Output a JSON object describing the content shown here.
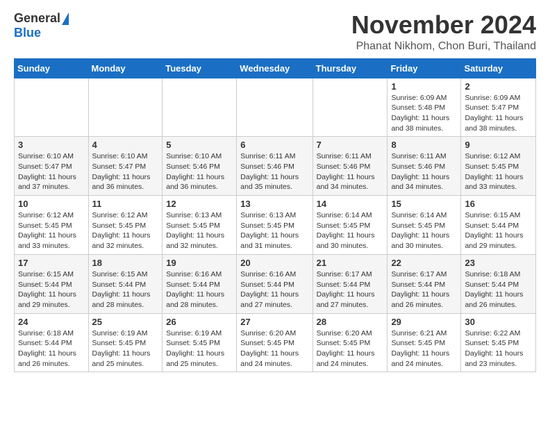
{
  "header": {
    "logo_general": "General",
    "logo_blue": "Blue",
    "month_title": "November 2024",
    "location": "Phanat Nikhom, Chon Buri, Thailand"
  },
  "weekdays": [
    "Sunday",
    "Monday",
    "Tuesday",
    "Wednesday",
    "Thursday",
    "Friday",
    "Saturday"
  ],
  "weeks": [
    [
      {
        "day": "",
        "info": ""
      },
      {
        "day": "",
        "info": ""
      },
      {
        "day": "",
        "info": ""
      },
      {
        "day": "",
        "info": ""
      },
      {
        "day": "",
        "info": ""
      },
      {
        "day": "1",
        "info": "Sunrise: 6:09 AM\nSunset: 5:48 PM\nDaylight: 11 hours and 38 minutes."
      },
      {
        "day": "2",
        "info": "Sunrise: 6:09 AM\nSunset: 5:47 PM\nDaylight: 11 hours and 38 minutes."
      }
    ],
    [
      {
        "day": "3",
        "info": "Sunrise: 6:10 AM\nSunset: 5:47 PM\nDaylight: 11 hours and 37 minutes."
      },
      {
        "day": "4",
        "info": "Sunrise: 6:10 AM\nSunset: 5:47 PM\nDaylight: 11 hours and 36 minutes."
      },
      {
        "day": "5",
        "info": "Sunrise: 6:10 AM\nSunset: 5:46 PM\nDaylight: 11 hours and 36 minutes."
      },
      {
        "day": "6",
        "info": "Sunrise: 6:11 AM\nSunset: 5:46 PM\nDaylight: 11 hours and 35 minutes."
      },
      {
        "day": "7",
        "info": "Sunrise: 6:11 AM\nSunset: 5:46 PM\nDaylight: 11 hours and 34 minutes."
      },
      {
        "day": "8",
        "info": "Sunrise: 6:11 AM\nSunset: 5:46 PM\nDaylight: 11 hours and 34 minutes."
      },
      {
        "day": "9",
        "info": "Sunrise: 6:12 AM\nSunset: 5:45 PM\nDaylight: 11 hours and 33 minutes."
      }
    ],
    [
      {
        "day": "10",
        "info": "Sunrise: 6:12 AM\nSunset: 5:45 PM\nDaylight: 11 hours and 33 minutes."
      },
      {
        "day": "11",
        "info": "Sunrise: 6:12 AM\nSunset: 5:45 PM\nDaylight: 11 hours and 32 minutes."
      },
      {
        "day": "12",
        "info": "Sunrise: 6:13 AM\nSunset: 5:45 PM\nDaylight: 11 hours and 32 minutes."
      },
      {
        "day": "13",
        "info": "Sunrise: 6:13 AM\nSunset: 5:45 PM\nDaylight: 11 hours and 31 minutes."
      },
      {
        "day": "14",
        "info": "Sunrise: 6:14 AM\nSunset: 5:45 PM\nDaylight: 11 hours and 30 minutes."
      },
      {
        "day": "15",
        "info": "Sunrise: 6:14 AM\nSunset: 5:45 PM\nDaylight: 11 hours and 30 minutes."
      },
      {
        "day": "16",
        "info": "Sunrise: 6:15 AM\nSunset: 5:44 PM\nDaylight: 11 hours and 29 minutes."
      }
    ],
    [
      {
        "day": "17",
        "info": "Sunrise: 6:15 AM\nSunset: 5:44 PM\nDaylight: 11 hours and 29 minutes."
      },
      {
        "day": "18",
        "info": "Sunrise: 6:15 AM\nSunset: 5:44 PM\nDaylight: 11 hours and 28 minutes."
      },
      {
        "day": "19",
        "info": "Sunrise: 6:16 AM\nSunset: 5:44 PM\nDaylight: 11 hours and 28 minutes."
      },
      {
        "day": "20",
        "info": "Sunrise: 6:16 AM\nSunset: 5:44 PM\nDaylight: 11 hours and 27 minutes."
      },
      {
        "day": "21",
        "info": "Sunrise: 6:17 AM\nSunset: 5:44 PM\nDaylight: 11 hours and 27 minutes."
      },
      {
        "day": "22",
        "info": "Sunrise: 6:17 AM\nSunset: 5:44 PM\nDaylight: 11 hours and 26 minutes."
      },
      {
        "day": "23",
        "info": "Sunrise: 6:18 AM\nSunset: 5:44 PM\nDaylight: 11 hours and 26 minutes."
      }
    ],
    [
      {
        "day": "24",
        "info": "Sunrise: 6:18 AM\nSunset: 5:44 PM\nDaylight: 11 hours and 26 minutes."
      },
      {
        "day": "25",
        "info": "Sunrise: 6:19 AM\nSunset: 5:45 PM\nDaylight: 11 hours and 25 minutes."
      },
      {
        "day": "26",
        "info": "Sunrise: 6:19 AM\nSunset: 5:45 PM\nDaylight: 11 hours and 25 minutes."
      },
      {
        "day": "27",
        "info": "Sunrise: 6:20 AM\nSunset: 5:45 PM\nDaylight: 11 hours and 24 minutes."
      },
      {
        "day": "28",
        "info": "Sunrise: 6:20 AM\nSunset: 5:45 PM\nDaylight: 11 hours and 24 minutes."
      },
      {
        "day": "29",
        "info": "Sunrise: 6:21 AM\nSunset: 5:45 PM\nDaylight: 11 hours and 24 minutes."
      },
      {
        "day": "30",
        "info": "Sunrise: 6:22 AM\nSunset: 5:45 PM\nDaylight: 11 hours and 23 minutes."
      }
    ]
  ]
}
